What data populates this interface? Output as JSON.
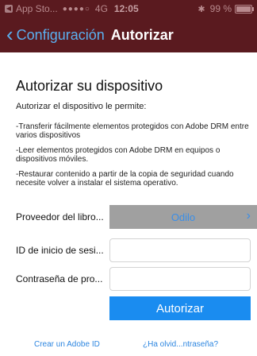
{
  "status_bar": {
    "back_app": "App Sto...",
    "signal": "●●●●○",
    "network": "4G",
    "time": "12:05",
    "bluetooth_icon": "bluetooth-icon",
    "battery": "99 %",
    "battery_level": 0.99
  },
  "nav": {
    "back_label": "Configuración",
    "title": "Autorizar"
  },
  "main": {
    "title": "Autorizar su dispositivo",
    "subtitle": "Autorizar el dispositivo le permite:",
    "bullets": [
      "-Transferir fácilmente elementos protegidos con Adobe DRM entre varios dispositivos",
      "-Leer elementos protegidos con Adobe DRM en equipos o dispositivos móviles.",
      "-Restaurar contenido a partir de la copia de seguridad cuando necesite volver a instalar el sistema operativo."
    ]
  },
  "form": {
    "provider_label": "Proveedor del libro...",
    "provider_value": "Odilo",
    "id_label": "ID de inicio de sesi...",
    "id_value": "",
    "password_label": "Contraseña de pro...",
    "password_value": "",
    "authorize_label": "Autorizar"
  },
  "links": {
    "create_adobe_id": "Crear un Adobe ID",
    "forgot_password": "¿Ha olvid...ntraseña?"
  },
  "colors": {
    "bar_background": "#5a1a1f",
    "accent": "#1a8cf0"
  }
}
